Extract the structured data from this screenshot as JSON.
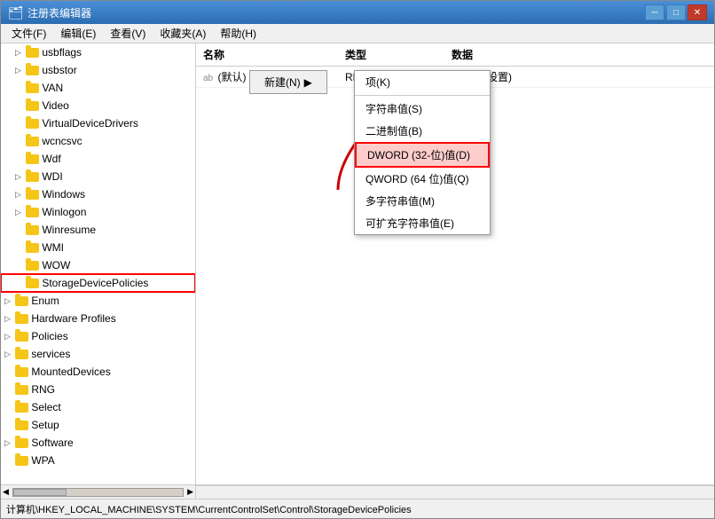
{
  "window": {
    "title": "注册表编辑器",
    "icon": "🗂"
  },
  "menu": {
    "items": [
      "文件(F)",
      "编辑(E)",
      "查看(V)",
      "收藏夹(A)",
      "帮助(H)"
    ]
  },
  "sidebar": {
    "items": [
      {
        "label": "usbflags",
        "indent": 1,
        "expanded": false
      },
      {
        "label": "usbstor",
        "indent": 1,
        "expanded": false
      },
      {
        "label": "VAN",
        "indent": 1,
        "expanded": false
      },
      {
        "label": "Video",
        "indent": 1,
        "expanded": false
      },
      {
        "label": "VirtualDeviceDrivers",
        "indent": 1,
        "expanded": false
      },
      {
        "label": "wcncsvc",
        "indent": 1,
        "expanded": false
      },
      {
        "label": "Wdf",
        "indent": 1,
        "expanded": false
      },
      {
        "label": "WDI",
        "indent": 1,
        "expanded": false
      },
      {
        "label": "Windows",
        "indent": 1,
        "expanded": false
      },
      {
        "label": "Winlogon",
        "indent": 1,
        "expanded": false
      },
      {
        "label": "Winresume",
        "indent": 1,
        "expanded": false
      },
      {
        "label": "WMI",
        "indent": 1,
        "expanded": false
      },
      {
        "label": "WOW",
        "indent": 1,
        "expanded": false
      },
      {
        "label": "StorageDevicePolicies",
        "indent": 1,
        "expanded": false,
        "highlighted": true
      },
      {
        "label": "Enum",
        "indent": 0,
        "expanded": false
      },
      {
        "label": "Hardware Profiles",
        "indent": 0,
        "expanded": false
      },
      {
        "label": "Policies",
        "indent": 0,
        "expanded": false
      },
      {
        "label": "services",
        "indent": 0,
        "expanded": false
      },
      {
        "label": "MountedDevices",
        "indent": 0,
        "expanded": false
      },
      {
        "label": "RNG",
        "indent": 0,
        "expanded": false
      },
      {
        "label": "Select",
        "indent": 0,
        "expanded": false
      },
      {
        "label": "Setup",
        "indent": 0,
        "expanded": false
      },
      {
        "label": "Software",
        "indent": 0,
        "expanded": false
      },
      {
        "label": "WPA",
        "indent": 0,
        "expanded": false
      }
    ]
  },
  "right_panel": {
    "columns": [
      "名称",
      "类型",
      "数据"
    ],
    "rows": [
      {
        "name": "(默认)",
        "type": "REG_SZ",
        "data": "(数值未设置)"
      }
    ]
  },
  "context_menu": {
    "new_button_label": "新建(N)",
    "arrow": "▶",
    "submenu_items": [
      {
        "label": "项(K)",
        "highlighted": false
      },
      {
        "label": "字符串值(S)",
        "highlighted": false
      },
      {
        "label": "二进制值(B)",
        "highlighted": false
      },
      {
        "label": "DWORD (32-位)值(D)",
        "highlighted": true
      },
      {
        "label": "QWORD (64 位)值(Q)",
        "highlighted": false
      },
      {
        "label": "多字符串值(M)",
        "highlighted": false
      },
      {
        "label": "可扩充字符串值(E)",
        "highlighted": false
      }
    ]
  },
  "status_bar": {
    "path": "计算机\\HKEY_LOCAL_MACHINE\\SYSTEM\\CurrentControlSet\\Control\\StorageDevicePolicies"
  },
  "title_controls": {
    "minimize": "─",
    "maximize": "□",
    "close": "✕"
  }
}
